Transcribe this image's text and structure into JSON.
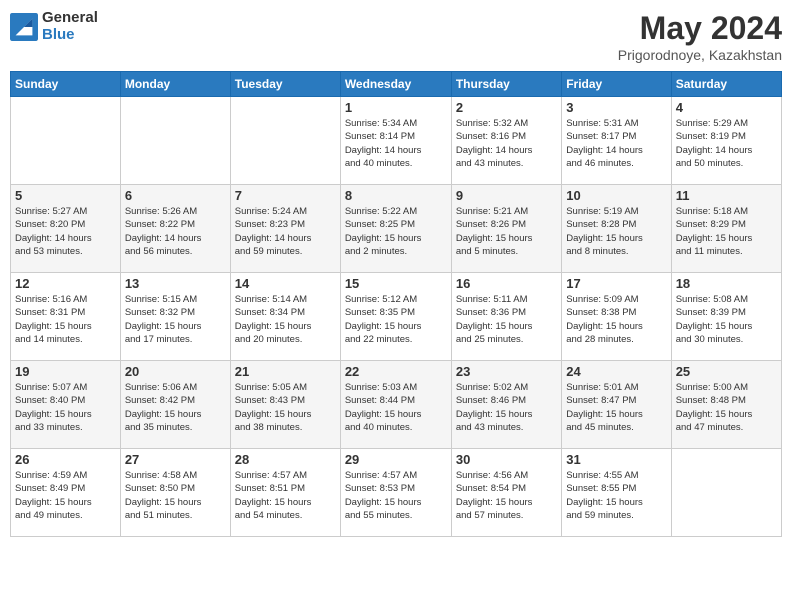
{
  "logo": {
    "general": "General",
    "blue": "Blue"
  },
  "header": {
    "month": "May 2024",
    "location": "Prigorodnoye, Kazakhstan"
  },
  "weekdays": [
    "Sunday",
    "Monday",
    "Tuesday",
    "Wednesday",
    "Thursday",
    "Friday",
    "Saturday"
  ],
  "weeks": [
    [
      {
        "day": "",
        "info": ""
      },
      {
        "day": "",
        "info": ""
      },
      {
        "day": "",
        "info": ""
      },
      {
        "day": "1",
        "info": "Sunrise: 5:34 AM\nSunset: 8:14 PM\nDaylight: 14 hours\nand 40 minutes."
      },
      {
        "day": "2",
        "info": "Sunrise: 5:32 AM\nSunset: 8:16 PM\nDaylight: 14 hours\nand 43 minutes."
      },
      {
        "day": "3",
        "info": "Sunrise: 5:31 AM\nSunset: 8:17 PM\nDaylight: 14 hours\nand 46 minutes."
      },
      {
        "day": "4",
        "info": "Sunrise: 5:29 AM\nSunset: 8:19 PM\nDaylight: 14 hours\nand 50 minutes."
      }
    ],
    [
      {
        "day": "5",
        "info": "Sunrise: 5:27 AM\nSunset: 8:20 PM\nDaylight: 14 hours\nand 53 minutes."
      },
      {
        "day": "6",
        "info": "Sunrise: 5:26 AM\nSunset: 8:22 PM\nDaylight: 14 hours\nand 56 minutes."
      },
      {
        "day": "7",
        "info": "Sunrise: 5:24 AM\nSunset: 8:23 PM\nDaylight: 14 hours\nand 59 minutes."
      },
      {
        "day": "8",
        "info": "Sunrise: 5:22 AM\nSunset: 8:25 PM\nDaylight: 15 hours\nand 2 minutes."
      },
      {
        "day": "9",
        "info": "Sunrise: 5:21 AM\nSunset: 8:26 PM\nDaylight: 15 hours\nand 5 minutes."
      },
      {
        "day": "10",
        "info": "Sunrise: 5:19 AM\nSunset: 8:28 PM\nDaylight: 15 hours\nand 8 minutes."
      },
      {
        "day": "11",
        "info": "Sunrise: 5:18 AM\nSunset: 8:29 PM\nDaylight: 15 hours\nand 11 minutes."
      }
    ],
    [
      {
        "day": "12",
        "info": "Sunrise: 5:16 AM\nSunset: 8:31 PM\nDaylight: 15 hours\nand 14 minutes."
      },
      {
        "day": "13",
        "info": "Sunrise: 5:15 AM\nSunset: 8:32 PM\nDaylight: 15 hours\nand 17 minutes."
      },
      {
        "day": "14",
        "info": "Sunrise: 5:14 AM\nSunset: 8:34 PM\nDaylight: 15 hours\nand 20 minutes."
      },
      {
        "day": "15",
        "info": "Sunrise: 5:12 AM\nSunset: 8:35 PM\nDaylight: 15 hours\nand 22 minutes."
      },
      {
        "day": "16",
        "info": "Sunrise: 5:11 AM\nSunset: 8:36 PM\nDaylight: 15 hours\nand 25 minutes."
      },
      {
        "day": "17",
        "info": "Sunrise: 5:09 AM\nSunset: 8:38 PM\nDaylight: 15 hours\nand 28 minutes."
      },
      {
        "day": "18",
        "info": "Sunrise: 5:08 AM\nSunset: 8:39 PM\nDaylight: 15 hours\nand 30 minutes."
      }
    ],
    [
      {
        "day": "19",
        "info": "Sunrise: 5:07 AM\nSunset: 8:40 PM\nDaylight: 15 hours\nand 33 minutes."
      },
      {
        "day": "20",
        "info": "Sunrise: 5:06 AM\nSunset: 8:42 PM\nDaylight: 15 hours\nand 35 minutes."
      },
      {
        "day": "21",
        "info": "Sunrise: 5:05 AM\nSunset: 8:43 PM\nDaylight: 15 hours\nand 38 minutes."
      },
      {
        "day": "22",
        "info": "Sunrise: 5:03 AM\nSunset: 8:44 PM\nDaylight: 15 hours\nand 40 minutes."
      },
      {
        "day": "23",
        "info": "Sunrise: 5:02 AM\nSunset: 8:46 PM\nDaylight: 15 hours\nand 43 minutes."
      },
      {
        "day": "24",
        "info": "Sunrise: 5:01 AM\nSunset: 8:47 PM\nDaylight: 15 hours\nand 45 minutes."
      },
      {
        "day": "25",
        "info": "Sunrise: 5:00 AM\nSunset: 8:48 PM\nDaylight: 15 hours\nand 47 minutes."
      }
    ],
    [
      {
        "day": "26",
        "info": "Sunrise: 4:59 AM\nSunset: 8:49 PM\nDaylight: 15 hours\nand 49 minutes."
      },
      {
        "day": "27",
        "info": "Sunrise: 4:58 AM\nSunset: 8:50 PM\nDaylight: 15 hours\nand 51 minutes."
      },
      {
        "day": "28",
        "info": "Sunrise: 4:57 AM\nSunset: 8:51 PM\nDaylight: 15 hours\nand 54 minutes."
      },
      {
        "day": "29",
        "info": "Sunrise: 4:57 AM\nSunset: 8:53 PM\nDaylight: 15 hours\nand 55 minutes."
      },
      {
        "day": "30",
        "info": "Sunrise: 4:56 AM\nSunset: 8:54 PM\nDaylight: 15 hours\nand 57 minutes."
      },
      {
        "day": "31",
        "info": "Sunrise: 4:55 AM\nSunset: 8:55 PM\nDaylight: 15 hours\nand 59 minutes."
      },
      {
        "day": "",
        "info": ""
      }
    ]
  ]
}
